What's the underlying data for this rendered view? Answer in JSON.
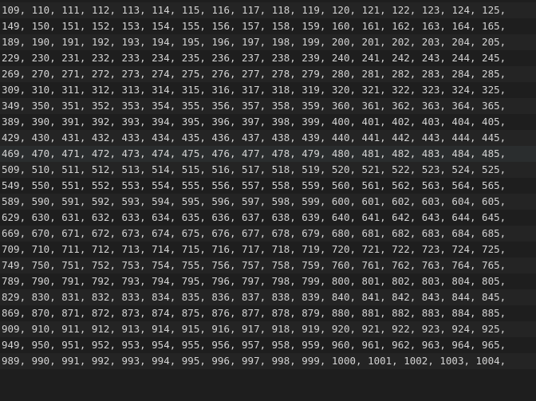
{
  "editor": {
    "highlight_row_index": 9,
    "rows": [
      {
        "start": 109,
        "end": 125
      },
      {
        "start": 149,
        "end": 165
      },
      {
        "start": 189,
        "end": 205
      },
      {
        "start": 229,
        "end": 245
      },
      {
        "start": 269,
        "end": 285
      },
      {
        "start": 309,
        "end": 325
      },
      {
        "start": 349,
        "end": 365
      },
      {
        "start": 389,
        "end": 405
      },
      {
        "start": 429,
        "end": 445
      },
      {
        "start": 469,
        "end": 485
      },
      {
        "start": 509,
        "end": 525
      },
      {
        "start": 549,
        "end": 565
      },
      {
        "start": 589,
        "end": 605
      },
      {
        "start": 629,
        "end": 645
      },
      {
        "start": 669,
        "end": 685
      },
      {
        "start": 709,
        "end": 725
      },
      {
        "start": 749,
        "end": 765
      },
      {
        "start": 789,
        "end": 805
      },
      {
        "start": 829,
        "end": 845
      },
      {
        "start": 869,
        "end": 885
      },
      {
        "start": 909,
        "end": 925
      },
      {
        "start": 949,
        "end": 965
      },
      {
        "start": 989,
        "end": 1004
      }
    ]
  }
}
